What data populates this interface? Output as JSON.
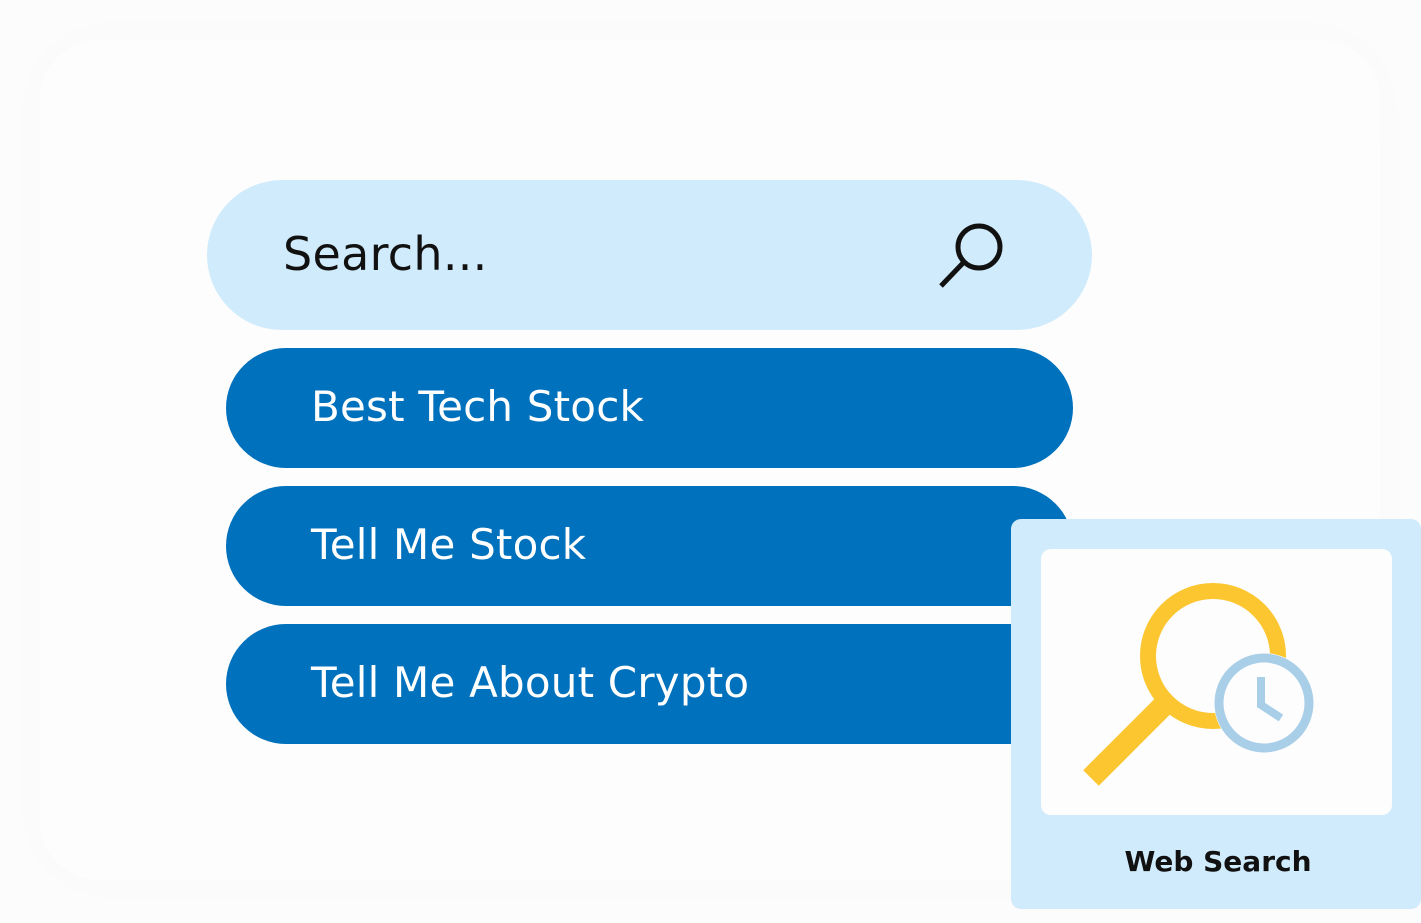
{
  "search": {
    "placeholder": "Search..."
  },
  "suggestions": [
    {
      "label": "Best Tech Stock"
    },
    {
      "label": "Tell Me Stock"
    },
    {
      "label": "Tell Me About Crypto"
    }
  ],
  "card": {
    "label": "Web Search",
    "icon": "magnifier-clock-icon"
  },
  "colors": {
    "search_bg": "#d0ebfb",
    "suggestion_bg": "#0071bc",
    "magnifier": "#fbc62f",
    "clock": "#a9cfe8"
  }
}
